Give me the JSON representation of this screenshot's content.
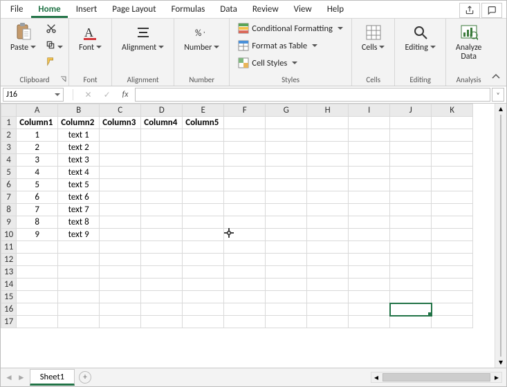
{
  "tabs": {
    "file": "File",
    "home": "Home",
    "insert": "Insert",
    "pagelayout": "Page Layout",
    "formulas": "Formulas",
    "data": "Data",
    "review": "Review",
    "view": "View",
    "help": "Help"
  },
  "ribbon": {
    "clipboard": {
      "paste": "Paste",
      "label": "Clipboard"
    },
    "font": {
      "btn": "Font",
      "label": "Font"
    },
    "align": {
      "btn": "Alignment",
      "label": "Alignment"
    },
    "number": {
      "btn": "Number",
      "label": "Number"
    },
    "styles": {
      "cond": "Conditional Formatting",
      "table": "Format as Table",
      "cell": "Cell Styles",
      "label": "Styles"
    },
    "cells": {
      "btn": "Cells",
      "label": "Cells"
    },
    "editing": {
      "btn": "Editing",
      "label": "Editing"
    },
    "analysis": {
      "btn": "Analyze\nData",
      "label": "Analysis"
    }
  },
  "namebox": "J16",
  "formula": "",
  "columns": [
    "A",
    "B",
    "C",
    "D",
    "E",
    "F",
    "G",
    "H",
    "I",
    "J",
    "K"
  ],
  "headers": [
    "Column1",
    "Column2",
    "Column3",
    "Column4",
    "Column5"
  ],
  "data_rows": [
    {
      "a": "1",
      "b": "text 1"
    },
    {
      "a": "2",
      "b": "text 2"
    },
    {
      "a": "3",
      "b": "text 3"
    },
    {
      "a": "4",
      "b": "text 4"
    },
    {
      "a": "5",
      "b": "text 5"
    },
    {
      "a": "6",
      "b": "text 6"
    },
    {
      "a": "7",
      "b": "text 7"
    },
    {
      "a": "8",
      "b": "text 8"
    },
    {
      "a": "9",
      "b": "text 9"
    }
  ],
  "total_rows": 17,
  "selected_cell": "J16",
  "sheet": "Sheet1"
}
